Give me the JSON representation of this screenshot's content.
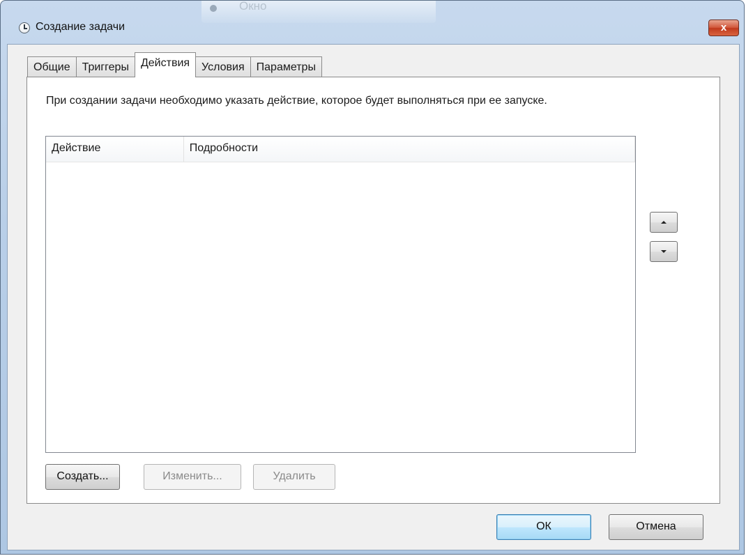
{
  "background_window": {
    "title": "Окно"
  },
  "window": {
    "title": "Создание задачи",
    "close_label": "x"
  },
  "tabs": [
    {
      "label": "Общие",
      "active": false
    },
    {
      "label": "Триггеры",
      "active": false
    },
    {
      "label": "Действия",
      "active": true
    },
    {
      "label": "Условия",
      "active": false
    },
    {
      "label": "Параметры",
      "active": false
    }
  ],
  "panel": {
    "description": "При создании задачи необходимо указать действие, которое будет выполняться при ее запуске."
  },
  "list": {
    "columns": [
      "Действие",
      "Подробности"
    ],
    "rows": []
  },
  "buttons": {
    "create": "Создать...",
    "edit": "Изменить...",
    "delete": "Удалить",
    "ok": "ОК",
    "cancel": "Отмена"
  },
  "colors": {
    "accent": "#3c7fb1",
    "close": "#c03a1d",
    "frame": "#b9cfe8"
  }
}
